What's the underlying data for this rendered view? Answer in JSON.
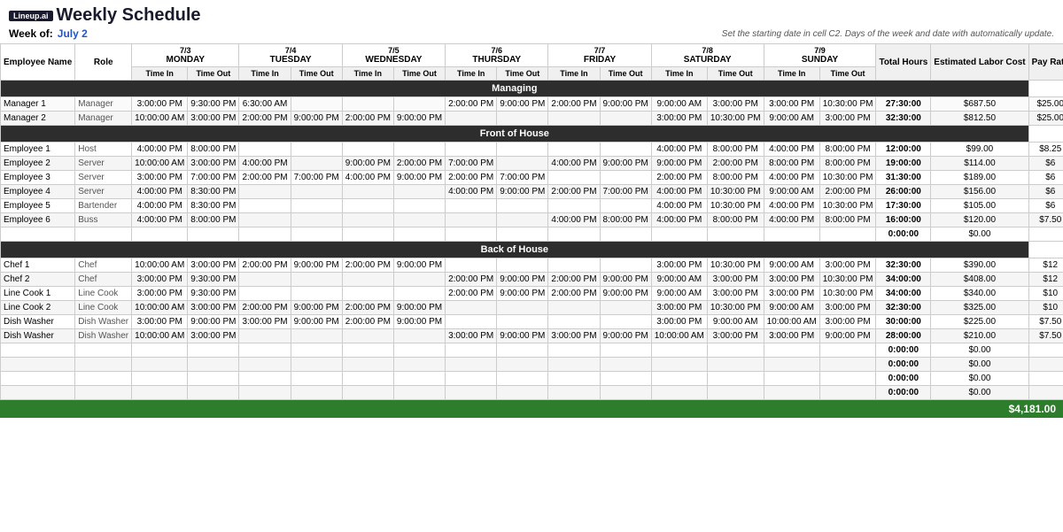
{
  "app": {
    "logo": "Lineup.ai",
    "title": "Weekly Schedule",
    "week_label": "Week of:",
    "week_date": "July 2",
    "hint": "Set the starting date in cell C2. Days of the week and date with automatically update."
  },
  "columns": {
    "days": [
      {
        "date": "7/3",
        "name": "MONDAY"
      },
      {
        "date": "7/4",
        "name": "TUESDAY"
      },
      {
        "date": "7/5",
        "name": "WEDNESDAY"
      },
      {
        "date": "7/6",
        "name": "THURSDAY"
      },
      {
        "date": "7/7",
        "name": "FRIDAY"
      },
      {
        "date": "7/8",
        "name": "SATURDAY"
      },
      {
        "date": "7/9",
        "name": "SUNDAY"
      }
    ]
  },
  "sections": [
    {
      "name": "Managing",
      "rows": [
        {
          "name": "Manager 1",
          "role": "Manager",
          "mon_in": "3:00:00 PM",
          "mon_out": "9:30:00 PM",
          "tue_in": "6:30:00 AM",
          "tue_out": "",
          "wed_in": "",
          "wed_out": "",
          "thu_in": "2:00:00 PM",
          "thu_out": "9:00:00 PM",
          "fri_in": "2:00:00 PM",
          "fri_out": "9:00:00 PM",
          "sat_in": "9:00:00 AM",
          "sat_out": "3:00:00 PM",
          "sun_in": "3:00:00 PM",
          "sun_out": "10:30:00 PM",
          "total": "27:30:00",
          "labor": "$687.50",
          "rate": "$25.00"
        },
        {
          "name": "Manager 2",
          "role": "Manager",
          "mon_in": "10:00:00 AM",
          "mon_out": "3:00:00 PM",
          "tue_in": "2:00:00 PM",
          "tue_out": "9:00:00 PM",
          "wed_in": "2:00:00 PM",
          "wed_out": "9:00:00 PM",
          "thu_in": "",
          "thu_out": "",
          "fri_in": "",
          "fri_out": "",
          "sat_in": "3:00:00 PM",
          "sat_out": "10:30:00 PM",
          "sun_in": "9:00:00 AM",
          "sun_out": "3:00:00 PM",
          "total": "32:30:00",
          "labor": "$812.50",
          "rate": "$25.00"
        }
      ]
    },
    {
      "name": "Front of House",
      "rows": [
        {
          "name": "Employee 1",
          "role": "Host",
          "mon_in": "4:00:00 PM",
          "mon_out": "8:00:00 PM",
          "tue_in": "",
          "tue_out": "",
          "wed_in": "",
          "wed_out": "",
          "thu_in": "",
          "thu_out": "",
          "fri_in": "",
          "fri_out": "",
          "sat_in": "4:00:00 PM",
          "sat_out": "8:00:00 PM",
          "sun_in": "4:00:00 PM",
          "sun_out": "8:00:00 PM",
          "total": "12:00:00",
          "labor": "$99.00",
          "rate": "$8.25"
        },
        {
          "name": "Employee 2",
          "role": "Server",
          "mon_in": "10:00:00 AM",
          "mon_out": "3:00:00 PM",
          "tue_in": "4:00:00 PM",
          "tue_out": "",
          "wed_in": "9:00:00 PM",
          "wed_out": "2:00:00 PM",
          "thu_in": "7:00:00 PM",
          "thu_out": "",
          "fri_in": "4:00:00 PM",
          "fri_out": "9:00:00 PM",
          "sat_in": "9:00:00 PM",
          "sat_out": "2:00:00 PM",
          "sun_in": "8:00:00 PM",
          "sun_out": "8:00:00 PM",
          "total": "19:00:00",
          "labor": "$114.00",
          "rate": "$6"
        },
        {
          "name": "Employee 3",
          "role": "Server",
          "mon_in": "3:00:00 PM",
          "mon_out": "7:00:00 PM",
          "tue_in": "2:00:00 PM",
          "tue_out": "7:00:00 PM",
          "wed_in": "4:00:00 PM",
          "wed_out": "9:00:00 PM",
          "thu_in": "2:00:00 PM",
          "thu_out": "7:00:00 PM",
          "fri_in": "",
          "fri_out": "",
          "sat_in": "2:00:00 PM",
          "sat_out": "8:00:00 PM",
          "sun_in": "4:00:00 PM",
          "sun_out": "10:30:00 PM",
          "total": "31:30:00",
          "labor": "$189.00",
          "rate": "$6"
        },
        {
          "name": "Employee 4",
          "role": "Server",
          "mon_in": "4:00:00 PM",
          "mon_out": "8:30:00 PM",
          "tue_in": "",
          "tue_out": "",
          "wed_in": "",
          "wed_out": "",
          "thu_in": "4:00:00 PM",
          "thu_out": "9:00:00 PM",
          "fri_in": "2:00:00 PM",
          "fri_out": "7:00:00 PM",
          "sat_in": "4:00:00 PM",
          "sat_out": "10:30:00 PM",
          "sun_in": "9:00:00 AM",
          "sun_out": "2:00:00 PM",
          "total": "26:00:00",
          "labor": "$156.00",
          "rate": "$6"
        },
        {
          "name": "Employee 5",
          "role": "Bartender",
          "mon_in": "4:00:00 PM",
          "mon_out": "8:30:00 PM",
          "tue_in": "",
          "tue_out": "",
          "wed_in": "",
          "wed_out": "",
          "thu_in": "",
          "thu_out": "",
          "fri_in": "",
          "fri_out": "",
          "sat_in": "4:00:00 PM",
          "sat_out": "10:30:00 PM",
          "sun_in": "4:00:00 PM",
          "sun_out": "10:30:00 PM",
          "total": "17:30:00",
          "labor": "$105.00",
          "rate": "$6"
        },
        {
          "name": "Employee 6",
          "role": "Buss",
          "mon_in": "4:00:00 PM",
          "mon_out": "8:00:00 PM",
          "tue_in": "",
          "tue_out": "",
          "wed_in": "",
          "wed_out": "",
          "thu_in": "",
          "thu_out": "",
          "fri_in": "4:00:00 PM",
          "fri_out": "8:00:00 PM",
          "sat_in": "4:00:00 PM",
          "sat_out": "8:00:00 PM",
          "sun_in": "4:00:00 PM",
          "sun_out": "8:00:00 PM",
          "total": "16:00:00",
          "labor": "$120.00",
          "rate": "$7.50"
        },
        {
          "name": "",
          "role": "",
          "mon_in": "",
          "mon_out": "",
          "tue_in": "",
          "tue_out": "",
          "wed_in": "",
          "wed_out": "",
          "thu_in": "",
          "thu_out": "",
          "fri_in": "",
          "fri_out": "",
          "sat_in": "",
          "sat_out": "",
          "sun_in": "",
          "sun_out": "",
          "total": "0:00:00",
          "labor": "$0.00",
          "rate": ""
        }
      ]
    },
    {
      "name": "Back of House",
      "rows": [
        {
          "name": "Chef 1",
          "role": "Chef",
          "mon_in": "10:00:00 AM",
          "mon_out": "3:00:00 PM",
          "tue_in": "2:00:00 PM",
          "tue_out": "9:00:00 PM",
          "wed_in": "2:00:00 PM",
          "wed_out": "9:00:00 PM",
          "thu_in": "",
          "thu_out": "",
          "fri_in": "",
          "fri_out": "",
          "sat_in": "3:00:00 PM",
          "sat_out": "10:30:00 PM",
          "sun_in": "9:00:00 AM",
          "sun_out": "3:00:00 PM",
          "total": "32:30:00",
          "labor": "$390.00",
          "rate": "$12"
        },
        {
          "name": "Chef 2",
          "role": "Chef",
          "mon_in": "3:00:00 PM",
          "mon_out": "9:30:00 PM",
          "tue_in": "",
          "tue_out": "",
          "wed_in": "",
          "wed_out": "",
          "thu_in": "2:00:00 PM",
          "thu_out": "9:00:00 PM",
          "fri_in": "2:00:00 PM",
          "fri_out": "9:00:00 PM",
          "sat_in": "9:00:00 AM",
          "sat_out": "3:00:00 PM",
          "sun_in": "3:00:00 PM",
          "sun_out": "10:30:00 PM",
          "total": "34:00:00",
          "labor": "$408.00",
          "rate": "$12"
        },
        {
          "name": "Line Cook 1",
          "role": "Line Cook",
          "mon_in": "3:00:00 PM",
          "mon_out": "9:30:00 PM",
          "tue_in": "",
          "tue_out": "",
          "wed_in": "",
          "wed_out": "",
          "thu_in": "2:00:00 PM",
          "thu_out": "9:00:00 PM",
          "fri_in": "2:00:00 PM",
          "fri_out": "9:00:00 PM",
          "sat_in": "9:00:00 AM",
          "sat_out": "3:00:00 PM",
          "sun_in": "3:00:00 PM",
          "sun_out": "10:30:00 PM",
          "total": "34:00:00",
          "labor": "$340.00",
          "rate": "$10"
        },
        {
          "name": "Line Cook 2",
          "role": "Line Cook",
          "mon_in": "10:00:00 AM",
          "mon_out": "3:00:00 PM",
          "tue_in": "2:00:00 PM",
          "tue_out": "9:00:00 PM",
          "wed_in": "2:00:00 PM",
          "wed_out": "9:00:00 PM",
          "thu_in": "",
          "thu_out": "",
          "fri_in": "",
          "fri_out": "",
          "sat_in": "3:00:00 PM",
          "sat_out": "10:30:00 PM",
          "sun_in": "9:00:00 AM",
          "sun_out": "3:00:00 PM",
          "total": "32:30:00",
          "labor": "$325.00",
          "rate": "$10"
        },
        {
          "name": "Dish Washer",
          "role": "Dish Washer",
          "mon_in": "3:00:00 PM",
          "mon_out": "9:00:00 PM",
          "tue_in": "3:00:00 PM",
          "tue_out": "9:00:00 PM",
          "wed_in": "2:00:00 PM",
          "wed_out": "9:00:00 PM",
          "thu_in": "",
          "thu_out": "",
          "fri_in": "",
          "fri_out": "",
          "sat_in": "3:00:00 PM",
          "sat_out": "9:00:00 AM",
          "sun_in": "10:00:00 AM",
          "sun_out": "3:00:00 PM",
          "total": "30:00:00",
          "labor": "$225.00",
          "rate": "$7.50"
        },
        {
          "name": "Dish Washer",
          "role": "Dish Washer",
          "mon_in": "10:00:00 AM",
          "mon_out": "3:00:00 PM",
          "tue_in": "",
          "tue_out": "",
          "wed_in": "",
          "wed_out": "",
          "thu_in": "3:00:00 PM",
          "thu_out": "9:00:00 PM",
          "fri_in": "3:00:00 PM",
          "fri_out": "9:00:00 PM",
          "sat_in": "10:00:00 AM",
          "sat_out": "3:00:00 PM",
          "sun_in": "3:00:00 PM",
          "sun_out": "9:00:00 PM",
          "total": "28:00:00",
          "labor": "$210.00",
          "rate": "$7.50"
        },
        {
          "name": "",
          "role": "",
          "mon_in": "",
          "mon_out": "",
          "tue_in": "",
          "tue_out": "",
          "wed_in": "",
          "wed_out": "",
          "thu_in": "",
          "thu_out": "",
          "fri_in": "",
          "fri_out": "",
          "sat_in": "",
          "sat_out": "",
          "sun_in": "",
          "sun_out": "",
          "total": "0:00:00",
          "labor": "$0.00",
          "rate": ""
        },
        {
          "name": "",
          "role": "",
          "mon_in": "",
          "mon_out": "",
          "tue_in": "",
          "tue_out": "",
          "wed_in": "",
          "wed_out": "",
          "thu_in": "",
          "thu_out": "",
          "fri_in": "",
          "fri_out": "",
          "sat_in": "",
          "sat_out": "",
          "sun_in": "",
          "sun_out": "",
          "total": "0:00:00",
          "labor": "$0.00",
          "rate": ""
        },
        {
          "name": "",
          "role": "",
          "mon_in": "",
          "mon_out": "",
          "tue_in": "",
          "tue_out": "",
          "wed_in": "",
          "wed_out": "",
          "thu_in": "",
          "thu_out": "",
          "fri_in": "",
          "fri_out": "",
          "sat_in": "",
          "sat_out": "",
          "sun_in": "",
          "sun_out": "",
          "total": "0:00:00",
          "labor": "$0.00",
          "rate": ""
        },
        {
          "name": "",
          "role": "",
          "mon_in": "",
          "mon_out": "",
          "tue_in": "",
          "tue_out": "",
          "wed_in": "",
          "wed_out": "",
          "thu_in": "",
          "thu_out": "",
          "fri_in": "",
          "fri_out": "",
          "sat_in": "",
          "sat_out": "",
          "sun_in": "",
          "sun_out": "",
          "total": "0:00:00",
          "labor": "$0.00",
          "rate": ""
        }
      ]
    }
  ],
  "grand_total": "$4,181.00",
  "labels": {
    "employee_name": "Employee Name",
    "role": "Role",
    "time_in": "Time In",
    "time_out": "Time Out",
    "total_hours": "Total Hours",
    "estimated_labor": "Estimated Labor Cost",
    "pay_rate": "Pay Rate"
  }
}
